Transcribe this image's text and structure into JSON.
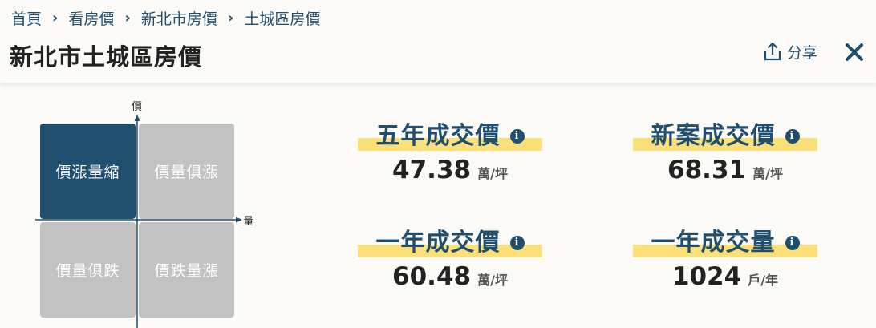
{
  "breadcrumb": {
    "items": [
      "首頁",
      "看房價",
      "新北市房價",
      "土城區房價"
    ]
  },
  "header": {
    "title": "新北市土城區房價",
    "share_label": "分享"
  },
  "quadrant": {
    "y_axis_label": "價",
    "x_axis_label": "量",
    "cells": [
      "價漲量縮",
      "價量俱漲",
      "價量俱跌",
      "價跌量漲"
    ],
    "active_cell": "價漲量縮"
  },
  "stats": [
    {
      "title": "五年成交價",
      "value": "47.38",
      "unit": "萬/坪"
    },
    {
      "title": "新案成交價",
      "value": "68.31",
      "unit": "萬/坪"
    },
    {
      "title": "一年成交價",
      "value": "60.48",
      "unit": "萬/坪"
    },
    {
      "title": "一年成交量",
      "value": "1024",
      "unit": "戶/年"
    }
  ],
  "colors": {
    "primary": "#1f4e6e",
    "highlight": "#fbe07a",
    "inactive_cell": "#c2c2c2",
    "background": "#fbfaf6"
  }
}
